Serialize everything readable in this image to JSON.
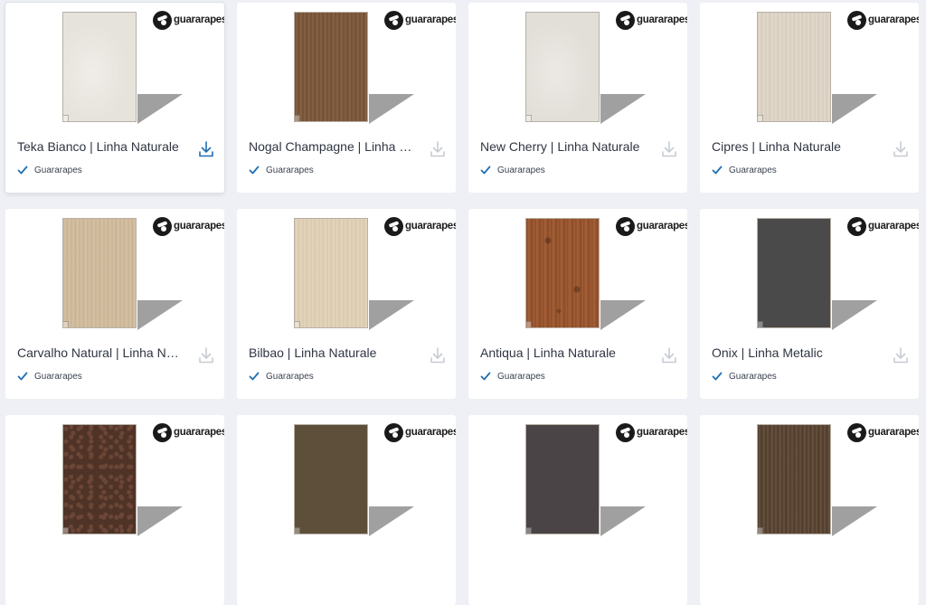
{
  "cards": [
    {
      "title": "Teka Bianco | Linha Naturale",
      "brand": "Guararapes",
      "logo": "guararapes",
      "swatch": "#e6e2dc",
      "swatch2": "#f0ede8",
      "pattern": "light",
      "active": true
    },
    {
      "title": "Nogal Champagne | Linha Naturale",
      "brand": "Guararapes",
      "logo": "guararapes",
      "swatch": "#6f4e33",
      "swatch2": "#8a6446",
      "pattern": "stripes",
      "active": false
    },
    {
      "title": "New Cherry | Linha Naturale",
      "brand": "Guararapes",
      "logo": "guararapes",
      "swatch": "#e2dfd9",
      "swatch2": "#ece9e4",
      "pattern": "light",
      "active": false
    },
    {
      "title": "Cipres | Linha Naturale",
      "brand": "Guararapes",
      "logo": "guararapes",
      "swatch": "#d6ccbd",
      "swatch2": "#e3dacd",
      "pattern": "stripes",
      "active": false
    },
    {
      "title": "Carvalho Natural | Linha Naturale",
      "brand": "Guararapes",
      "logo": "guararapes",
      "swatch": "#c9b293",
      "swatch2": "#d6c2a6",
      "pattern": "stripes",
      "active": false
    },
    {
      "title": "Bilbao | Linha Naturale",
      "brand": "Guararapes",
      "logo": "guararapes",
      "swatch": "#d8c8ab",
      "swatch2": "#e4d7bf",
      "pattern": "stripes",
      "active": false
    },
    {
      "title": "Antiqua | Linha Naturale",
      "brand": "Guararapes",
      "logo": "guararapes",
      "swatch": "#8a4b26",
      "swatch2": "#a5623a",
      "pattern": "knots",
      "active": false
    },
    {
      "title": "Onix | Linha Metalic",
      "brand": "Guararapes",
      "logo": "guararapes",
      "swatch": "#4a4a4a",
      "swatch2": "#555555",
      "pattern": "flat",
      "active": false
    },
    {
      "title": "",
      "brand": "",
      "logo": "guararapes",
      "swatch": "#4f3327",
      "swatch2": "#6b4636",
      "pattern": "speckle",
      "active": false
    },
    {
      "title": "",
      "brand": "",
      "logo": "guararapes",
      "swatch": "#5e4f3a",
      "swatch2": "#665640",
      "pattern": "flat",
      "active": false
    },
    {
      "title": "",
      "brand": "",
      "logo": "guararapes",
      "swatch": "#4a4446",
      "swatch2": "#524b4e",
      "pattern": "flat",
      "active": false
    },
    {
      "title": "",
      "brand": "",
      "logo": "guararapes",
      "swatch": "#4d3a2b",
      "swatch2": "#6a5340",
      "pattern": "stripes",
      "active": false
    }
  ],
  "colors": {
    "accent": "#1f6fb2",
    "icon_muted": "#c7cbd3",
    "check": "#1f6fb2"
  },
  "icons": {
    "download": "download-icon",
    "check": "check-icon",
    "logo": "guararapes-logo-icon"
  }
}
